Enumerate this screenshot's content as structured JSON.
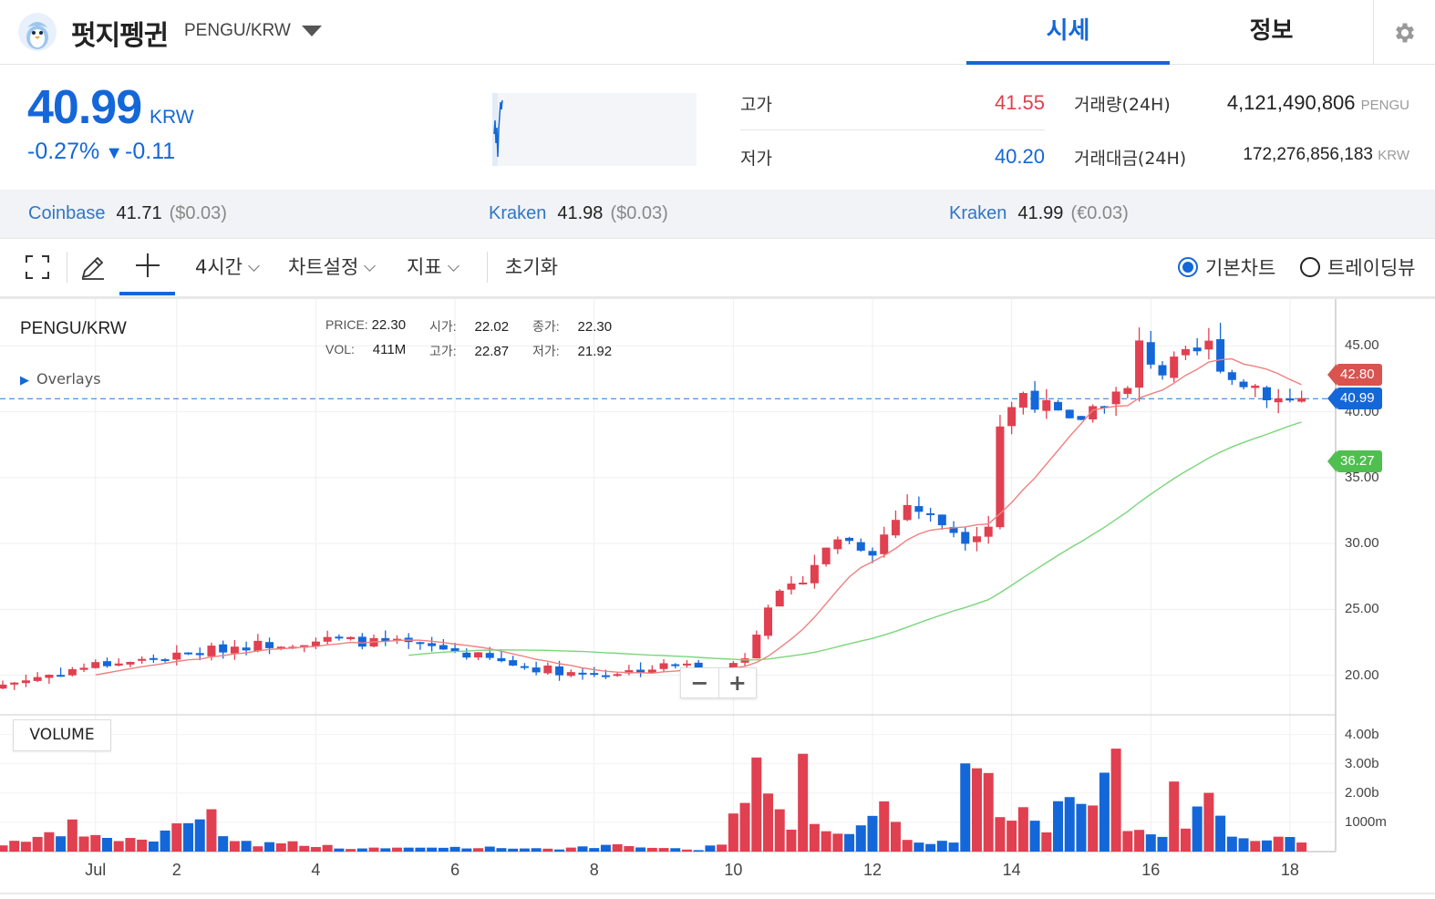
{
  "header": {
    "coin_name": "펏지펭귄",
    "pair": "PENGU/KRW",
    "tabs": [
      {
        "label": "시세",
        "active": true
      },
      {
        "label": "정보",
        "active": false
      }
    ],
    "settings_icon": "gear-icon"
  },
  "price": {
    "current": "40.99",
    "unit": "KRW",
    "change_pct": "-0.27%",
    "change_abs": "-0.11",
    "change_arrow": "▼",
    "color_down": "#1467d8",
    "color_up": "#e04050"
  },
  "stats": {
    "high_label": "고가",
    "high_value": "41.55",
    "low_label": "저가",
    "low_value": "40.20",
    "volume_label": "거래량(24H)",
    "volume_value": "4,121,490,806",
    "volume_unit": "PENGU",
    "turnover_label": "거래대금(24H)",
    "turnover_value": "172,276,856,183",
    "turnover_unit": "KRW"
  },
  "exchanges": [
    {
      "name": "Coinbase",
      "price": "41.71",
      "fx": "($0.03)"
    },
    {
      "name": "Kraken",
      "price": "41.98",
      "fx": "($0.03)"
    },
    {
      "name": "Kraken",
      "price": "41.99",
      "fx": "(€0.03)"
    }
  ],
  "toolbar": {
    "interval": "4시간",
    "chart_settings": "차트설정",
    "indicators": "지표",
    "reset": "초기화",
    "basic_chart": "기본차트",
    "tradingview": "트레이딩뷰",
    "selected_chart": "basic"
  },
  "chart": {
    "pair_label": "PENGU/KRW",
    "overlays_label": "Overlays",
    "volume_label": "VOLUME",
    "ohlc": {
      "price_label": "PRICE:",
      "price": "22.30",
      "open_label": "시가:",
      "open": "22.02",
      "close_label": "종가:",
      "close": "22.30",
      "vol_label": "VOL:",
      "vol": "411M",
      "high_label": "고가:",
      "high": "22.87",
      "low_label": "저가:",
      "low": "21.92"
    },
    "tags": {
      "ma_short": "42.80",
      "current": "40.99",
      "ma_long": "36.27"
    },
    "zoom_out": "−",
    "zoom_in": "+"
  },
  "chart_data": {
    "type": "candlestick",
    "title": "PENGU/KRW",
    "interval": "4h",
    "price_axis": {
      "ticks": [
        "45.00",
        "40.00",
        "35.00",
        "30.00",
        "25.00",
        "20.00"
      ],
      "range": [
        17,
        48
      ]
    },
    "volume_axis": {
      "ticks": [
        "4.00b",
        "3.00b",
        "2.00b",
        "1000m"
      ],
      "range": [
        0,
        4.3
      ]
    },
    "x_ticks": [
      "Jul",
      "2",
      "4",
      "6",
      "8",
      "10",
      "12",
      "14",
      "16",
      "18"
    ],
    "current_price": 40.99,
    "series": [
      {
        "name": "candles",
        "color_up": "#e04050",
        "color_down": "#1467d8"
      },
      {
        "name": "ma_short",
        "color": "#ef8080"
      },
      {
        "name": "ma_long",
        "color": "#7ad67a"
      }
    ],
    "close_anchors": [
      [
        0,
        19.3
      ],
      [
        8,
        20.8
      ],
      [
        14,
        21.3
      ],
      [
        20,
        22.2
      ],
      [
        28,
        22.7
      ],
      [
        34,
        22.4
      ],
      [
        38,
        22.0
      ],
      [
        44,
        20.8
      ],
      [
        50,
        20.1
      ],
      [
        54,
        20.3
      ],
      [
        58,
        20.8
      ],
      [
        62,
        20.4
      ],
      [
        64,
        21.5
      ],
      [
        66,
        25.5
      ],
      [
        68,
        26.5
      ],
      [
        72,
        30.5
      ],
      [
        75,
        29.5
      ],
      [
        78,
        33.0
      ],
      [
        80,
        32.0
      ],
      [
        83,
        30.5
      ],
      [
        85,
        31.5
      ],
      [
        86,
        39.0
      ],
      [
        88,
        41.5
      ],
      [
        92,
        39.0
      ],
      [
        95,
        41.0
      ],
      [
        97,
        41.5
      ],
      [
        98,
        45.0
      ],
      [
        100,
        43.0
      ],
      [
        104,
        45.0
      ],
      [
        106,
        42.5
      ],
      [
        108,
        42.0
      ],
      [
        110,
        41.0
      ],
      [
        112,
        40.99
      ]
    ],
    "volume_anchors": [
      [
        0,
        0.25
      ],
      [
        2,
        0.45
      ],
      [
        5,
        0.55
      ],
      [
        6,
        0.85
      ],
      [
        8,
        0.45
      ],
      [
        13,
        0.4
      ],
      [
        18,
        1.5
      ],
      [
        19,
        0.5
      ],
      [
        22,
        0.25
      ],
      [
        25,
        0.3
      ],
      [
        30,
        0.1
      ],
      [
        40,
        0.15
      ],
      [
        48,
        0.1
      ],
      [
        53,
        0.2
      ],
      [
        60,
        0.05
      ],
      [
        62,
        0.3
      ],
      [
        64,
        2.2
      ],
      [
        65,
        3.0
      ],
      [
        66,
        1.8
      ],
      [
        68,
        0.6
      ],
      [
        69,
        3.1
      ],
      [
        70,
        1.2
      ],
      [
        72,
        0.6
      ],
      [
        74,
        1.0
      ],
      [
        76,
        1.5
      ],
      [
        78,
        0.4
      ],
      [
        82,
        0.3
      ],
      [
        83,
        2.6
      ],
      [
        84,
        3.4
      ],
      [
        86,
        1.0
      ],
      [
        88,
        1.8
      ],
      [
        90,
        0.7
      ],
      [
        92,
        2.3
      ],
      [
        94,
        1.6
      ],
      [
        96,
        3.2
      ],
      [
        97,
        0.7
      ],
      [
        100,
        0.4
      ],
      [
        101,
        2.0
      ],
      [
        102,
        0.7
      ],
      [
        104,
        1.9
      ],
      [
        106,
        0.6
      ],
      [
        108,
        0.45
      ],
      [
        110,
        0.4
      ]
    ]
  }
}
